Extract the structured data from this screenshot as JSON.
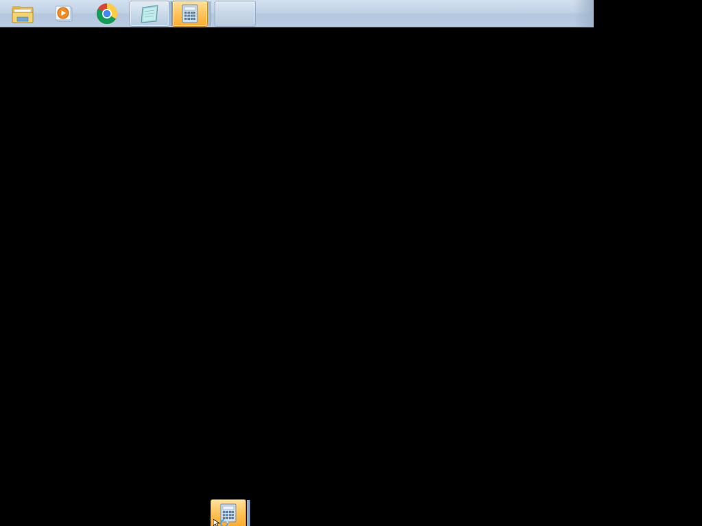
{
  "screen": {
    "background": "#000000"
  },
  "taskbar": {
    "accent_active": "#ffc35a",
    "items": [
      {
        "name": "file-explorer",
        "icon": "folder-icon",
        "state": "pinned"
      },
      {
        "name": "media-player",
        "icon": "media-player-icon",
        "state": "pinned"
      },
      {
        "name": "chrome",
        "icon": "chrome-icon",
        "state": "pinned"
      },
      {
        "name": "notepad",
        "icon": "notepad-icon",
        "state": "running"
      },
      {
        "name": "calculator",
        "icon": "calculator-icon",
        "state": "active"
      },
      {
        "name": "blank",
        "icon": "",
        "state": "empty"
      }
    ]
  },
  "drag_preview": {
    "icon": "calculator-icon",
    "cursor_icon": "busy-cursor-icon"
  }
}
